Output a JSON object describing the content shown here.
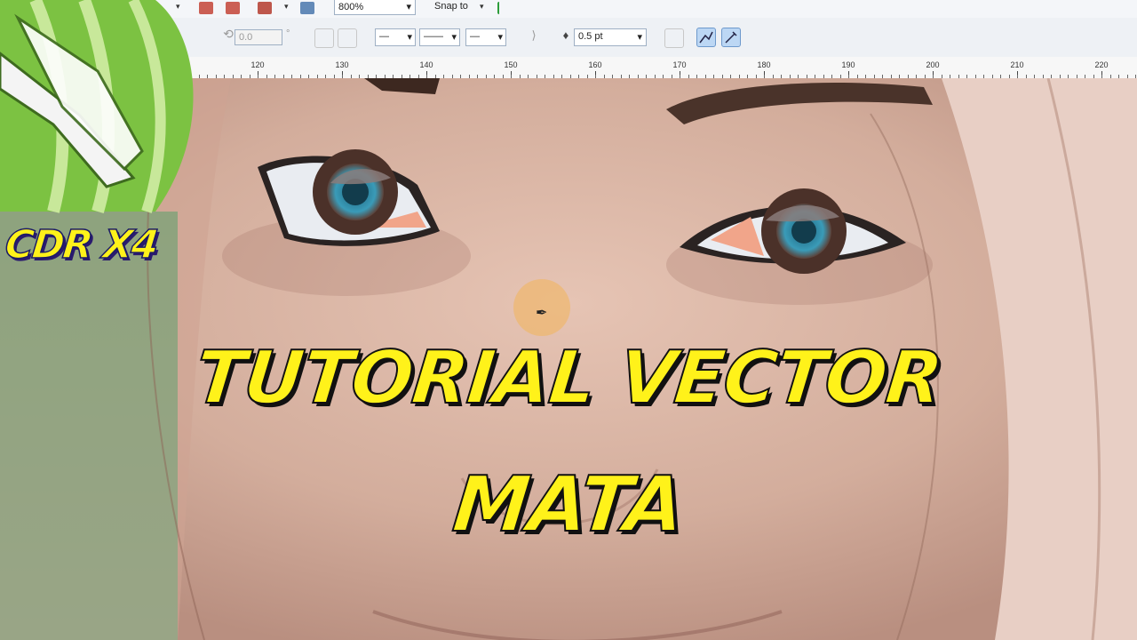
{
  "toolbar_top": {
    "zoom_value": "800%",
    "snap_label": "Snap to",
    "dropdown_arrow": "▾"
  },
  "property_bar": {
    "rotation_value": "0.0",
    "degree_symbol": "°",
    "outline_width": "0.5 pt",
    "line_style_start": "—",
    "line_style": "——",
    "line_style_end": "—"
  },
  "ruler": {
    "labels": [
      "120",
      "130",
      "140",
      "150",
      "160",
      "170",
      "180",
      "190",
      "200",
      "210",
      "220"
    ]
  },
  "overlay": {
    "app_badge": "CDR X4",
    "title_line1": "TUTORIAL VECTOR",
    "title_line2": "MATA"
  },
  "colors": {
    "title_yellow": "#fff21a",
    "logo_green": "#7cc242",
    "skin": "#d9b6a6",
    "iris": "#2d8aa6",
    "active_tool": "#bcd7f4"
  },
  "icons": [
    "zoom-dropdown-icon",
    "snap-icon",
    "rotate-icon",
    "mirror-horizontal-icon",
    "mirror-vertical-icon",
    "outline-pen-icon",
    "bezier-tool-icon",
    "pen-tool-icon",
    "cursor-pen-icon",
    "coreldraw-logo"
  ]
}
